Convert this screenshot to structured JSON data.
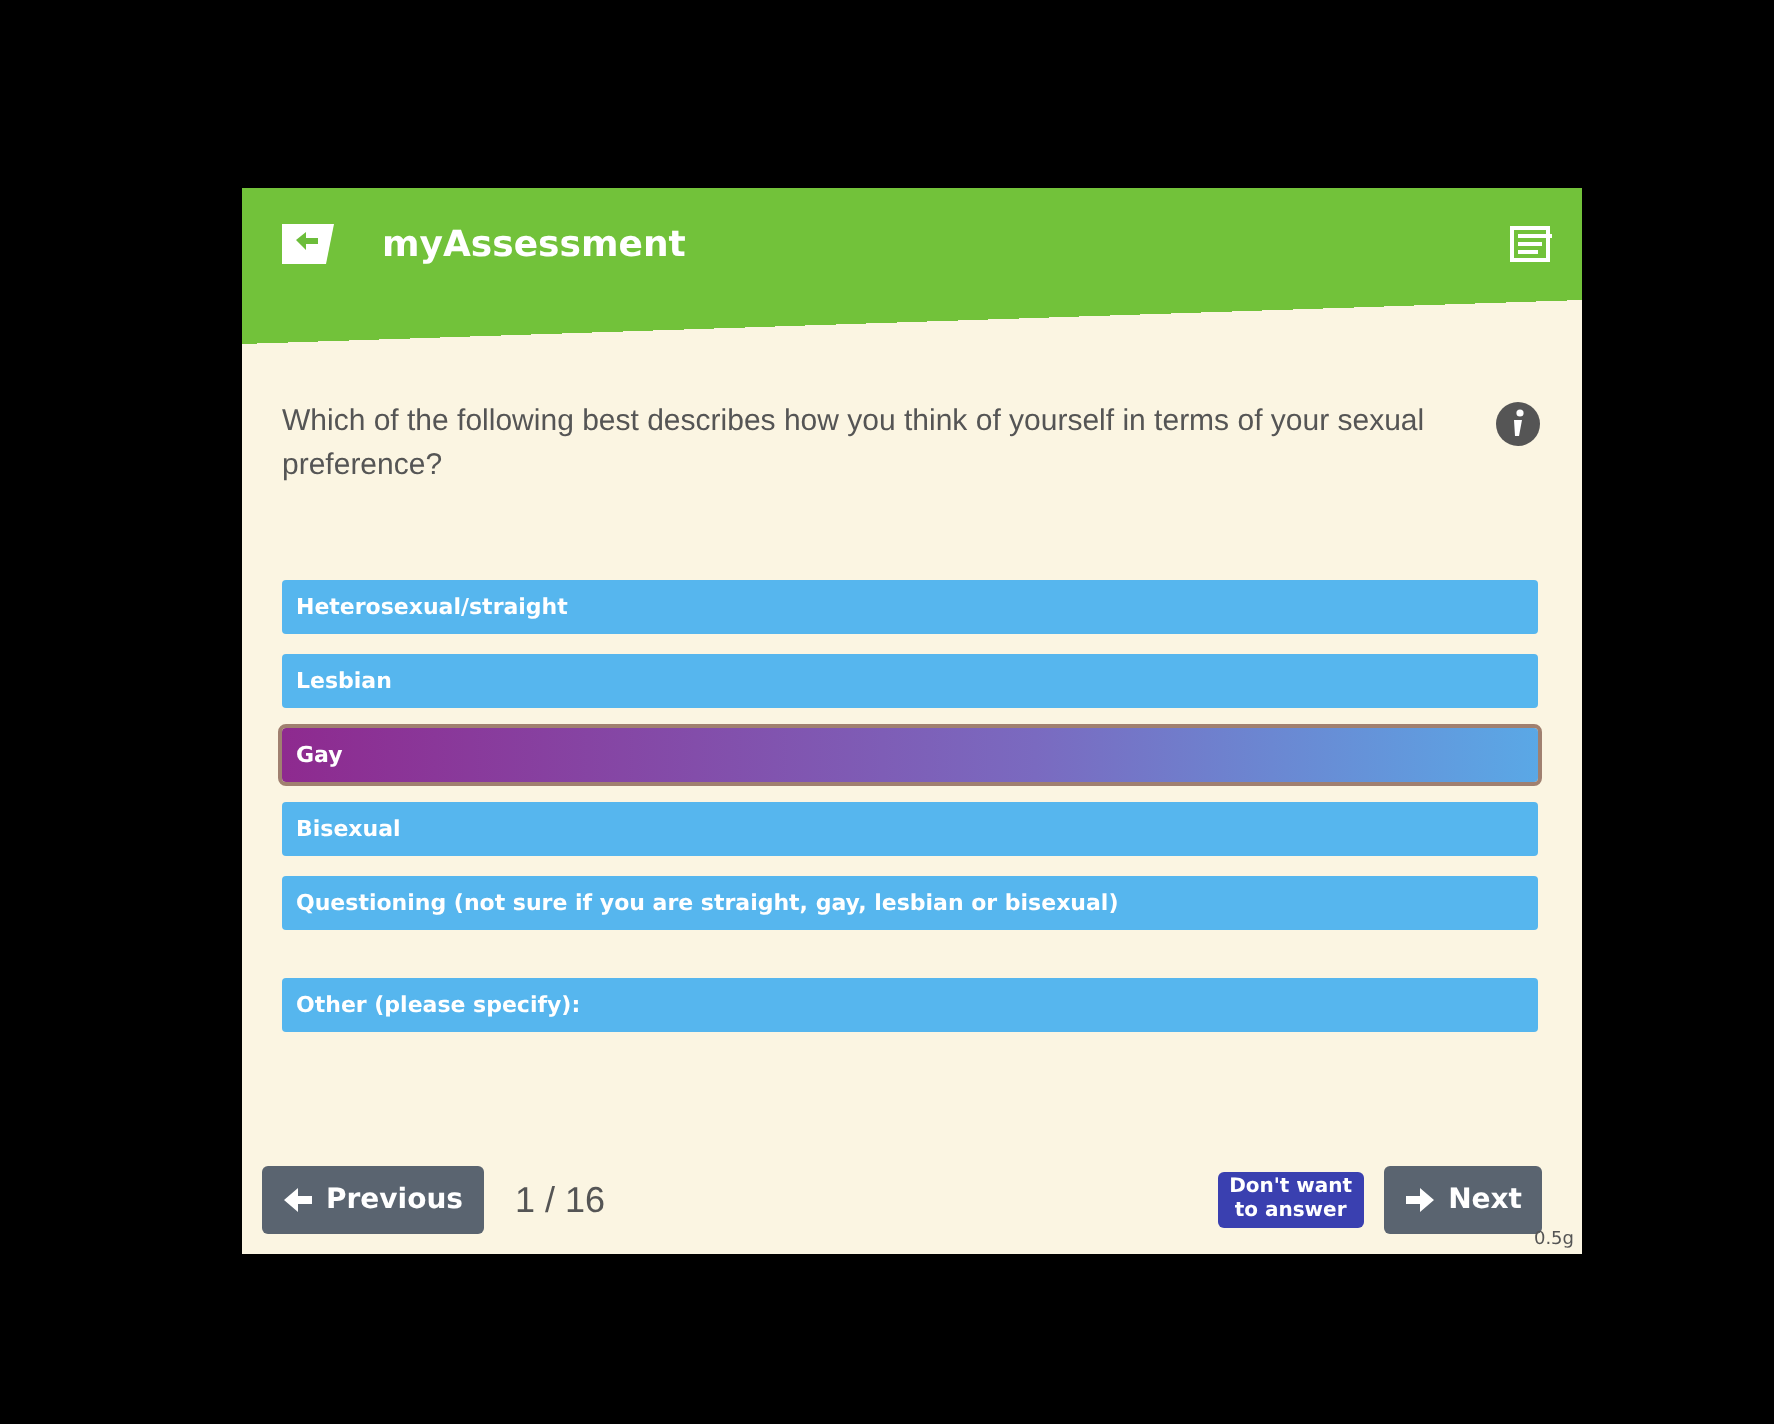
{
  "header": {
    "title": "myAssessment"
  },
  "question": {
    "text": "Which of the following best describes how you think of yourself in terms of your sexual preference?"
  },
  "options": [
    {
      "kind": "choice",
      "label": "Heterosexual/straight",
      "selected": false
    },
    {
      "kind": "choice",
      "label": "Lesbian",
      "selected": false
    },
    {
      "kind": "choice",
      "label": "Gay",
      "selected": true
    },
    {
      "kind": "choice",
      "label": "Bisexual",
      "selected": false
    },
    {
      "kind": "choice",
      "label": "Questioning (not sure if you are straight, gay, lesbian or bisexual)",
      "selected": false
    },
    {
      "kind": "other",
      "label": "Other (please specify):",
      "selected": false
    }
  ],
  "footer": {
    "previous": "Previous",
    "progress": "1 / 16",
    "skip": [
      "Don't want",
      "to answer"
    ],
    "next": "Next",
    "version": "0.5g"
  }
}
